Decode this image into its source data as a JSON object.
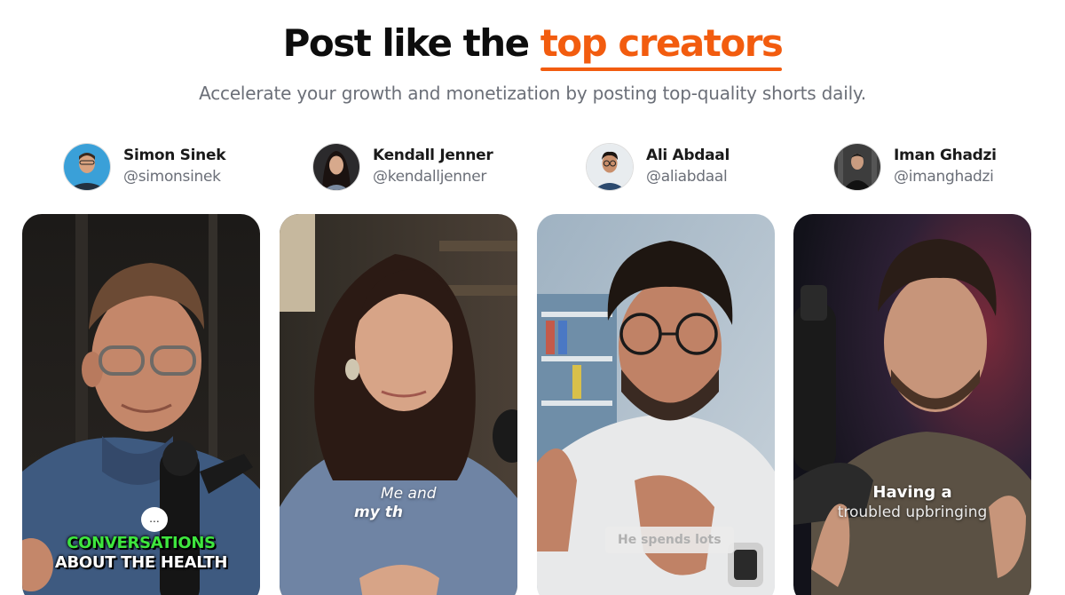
{
  "hero": {
    "title_prefix": "Post like the",
    "title_accent": "top creators",
    "subtitle": "Accelerate your growth and monetization by posting top-quality shorts daily."
  },
  "colors": {
    "accent": "#f25c0f",
    "caption_green": "#3ee63e"
  },
  "creators": [
    {
      "name": "Simon Sinek",
      "handle": "@simonsinek",
      "caption_lines": [
        "CONVERSATIONS",
        "ABOUT THE HEALTH"
      ],
      "icon": "chat-bubble-icon",
      "icon_text": "..."
    },
    {
      "name": "Kendall Jenner",
      "handle": "@kendalljenner",
      "caption_lines": [
        "Me and",
        "my th"
      ]
    },
    {
      "name": "Ali Abdaal",
      "handle": "@aliabdaal",
      "caption_lines": [
        "He spends lots"
      ]
    },
    {
      "name": "Iman Ghadzi",
      "handle": "@imanghadzi",
      "caption_lines": [
        "Having a",
        "troubled upbringing"
      ]
    }
  ]
}
